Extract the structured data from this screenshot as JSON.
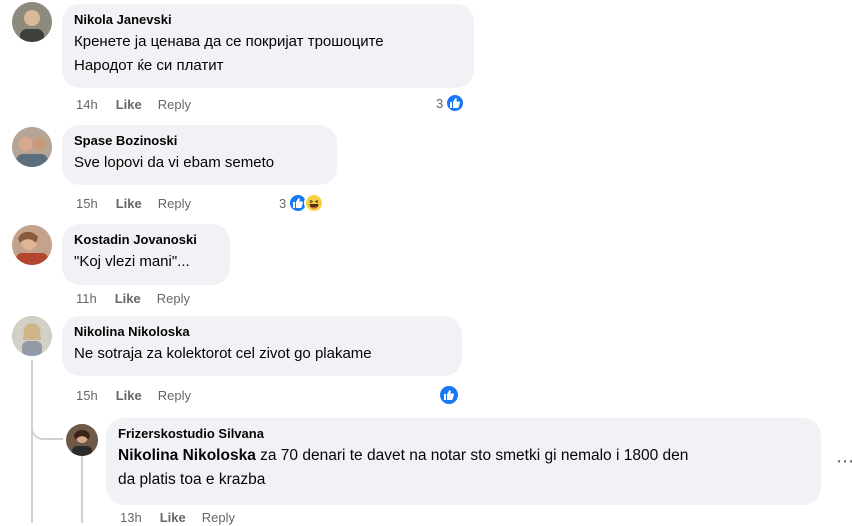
{
  "comments": [
    {
      "author": "Nikola Janevski",
      "lines": [
        "Кренете ја ценава да се покријат трошоците",
        "Народот ќе си платит"
      ],
      "time": "14h",
      "like": "Like",
      "reply": "Reply",
      "reaction_count": "3",
      "reactions": [
        "like-icon"
      ]
    },
    {
      "author": "Spase Bozinoski",
      "lines": [
        "Sve lopovi da vi ebam semeto"
      ],
      "time": "15h",
      "like": "Like",
      "reply": "Reply",
      "reaction_count": "3",
      "reactions": [
        "like-icon",
        "haha-icon"
      ]
    },
    {
      "author": "Kostadin Jovanoski",
      "lines": [
        "\"Koj vlezi mani\"..."
      ],
      "time": "11h",
      "like": "Like",
      "reply": "Reply"
    },
    {
      "author": "Nikolina Nikoloska",
      "lines": [
        "Ne sotraja za kolektorot cel zivot go plakame"
      ],
      "time": "15h",
      "like": "Like",
      "reply": "Reply",
      "reactions": [
        "like-icon"
      ]
    }
  ],
  "reply_comment": {
    "author": "Frizerskostudio Silvana",
    "mention": "Nikolina Nikoloska",
    "line1_rest": " za 70 denari te davet na notar sto smetki gi nemalo i 1800 den",
    "line2": "da platis toa e krazba",
    "time": "13h",
    "like": "Like",
    "reply": "Reply",
    "more": "⋯"
  },
  "colors": {
    "bubble": "#f0f2f5",
    "meta_text": "#65676b",
    "like_blue": "#1877f2",
    "thread_line": "#ced0d4"
  }
}
